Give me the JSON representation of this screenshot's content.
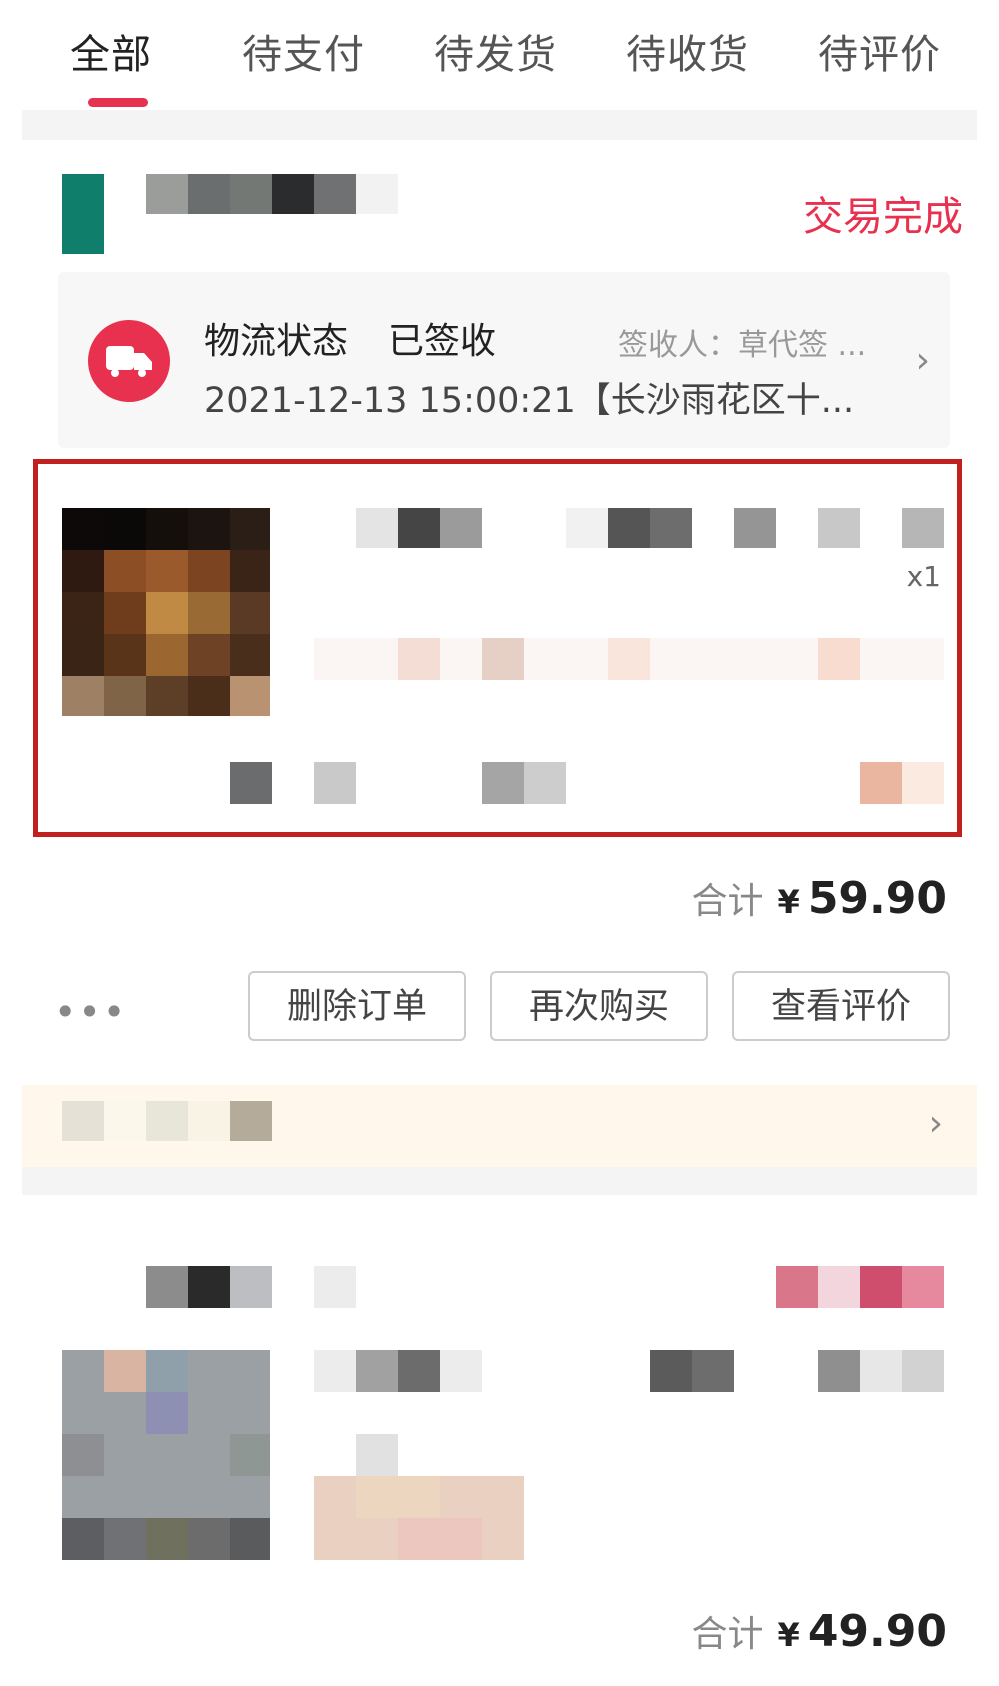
{
  "tabs": [
    {
      "label": "全部",
      "active": true
    },
    {
      "label": "待支付",
      "active": false
    },
    {
      "label": "待发货",
      "active": false
    },
    {
      "label": "待收货",
      "active": false
    },
    {
      "label": "待评价",
      "active": false
    }
  ],
  "colors": {
    "accent": "#e8304f",
    "highlight": "#c0201e"
  },
  "order1": {
    "status": "交易完成",
    "logistics": {
      "title": "物流状态",
      "state": "已签收",
      "signer": "签收人：草代签 ...",
      "detail": "2021-12-13 15:00:21【长沙雨花区十...",
      "icon": "truck-icon"
    },
    "quantity": "x1",
    "total_label": "合计",
    "currency": "¥",
    "total_value": "59.90",
    "more": "•••",
    "buttons": [
      "删除订单",
      "再次购买",
      "查看评价"
    ]
  },
  "order2": {
    "total_label": "合计",
    "currency": "¥",
    "total_value": "49.90"
  },
  "icons": {
    "chevron": "chevron-right-icon"
  }
}
